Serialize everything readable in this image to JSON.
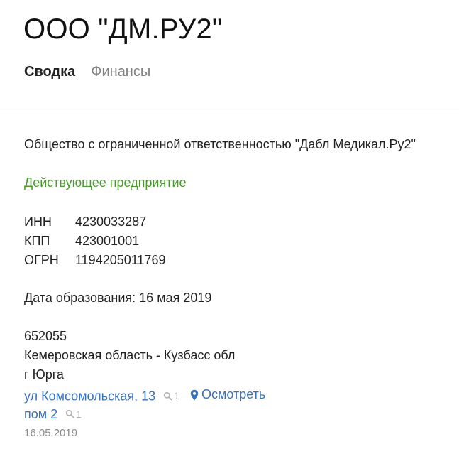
{
  "header": {
    "title": "ООО \"ДМ.РУ2\"",
    "tabs": [
      {
        "label": "Сводка",
        "active": true
      },
      {
        "label": "Финансы",
        "active": false
      }
    ]
  },
  "company": {
    "full_name": "Общество с ограниченной ответственностью \"Дабл Медикал.Ру2\"",
    "status": "Действующее предприятие",
    "status_color": "#4a9a2e",
    "codes": [
      {
        "label": "ИНН",
        "value": "4230033287"
      },
      {
        "label": "КПП",
        "value": "423001001"
      },
      {
        "label": "ОГРН",
        "value": "1194205011769"
      }
    ],
    "founded": "Дата образования: 16 мая 2019"
  },
  "address": {
    "postal_code": "652055",
    "region": "Кемеровская область - Кузбасс обл",
    "city": "г Юрга",
    "street": "ул Комсомольская, 13",
    "street_count": "1",
    "map_link": "Осмотреть",
    "room": "пом 2",
    "room_count": "1",
    "date": "16.05.2019"
  },
  "colors": {
    "link": "#3a72b8",
    "muted": "#b4b4b4"
  }
}
